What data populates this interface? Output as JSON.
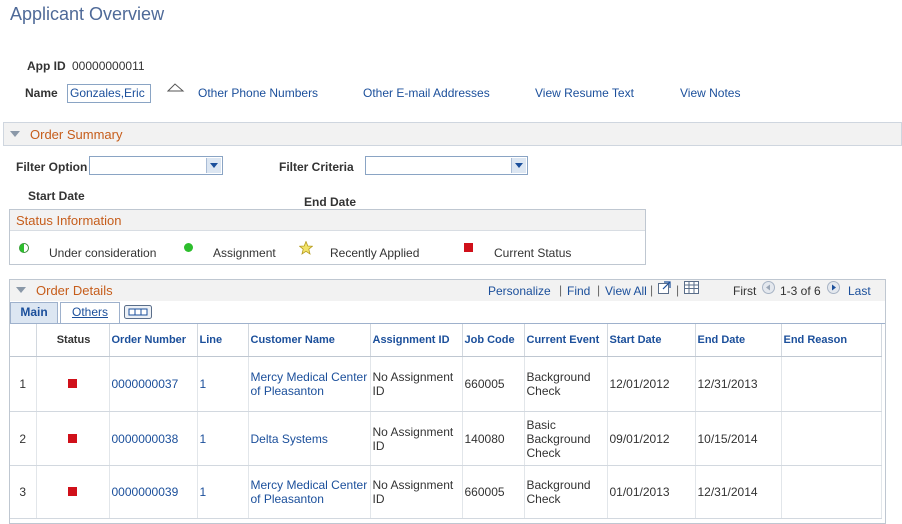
{
  "page": {
    "title": "Applicant Overview"
  },
  "applicant": {
    "app_id_label": "App ID",
    "app_id_value": "00000000011",
    "name_label": "Name",
    "name_value": "Gonzales,Eric",
    "links": [
      "Other Phone Numbers",
      "Other E-mail Addresses",
      "View Resume Text",
      "View Notes"
    ]
  },
  "order_summary": {
    "header": "Order Summary",
    "filter_option_label": "Filter Option",
    "filter_criteria_label": "Filter Criteria",
    "filter_option_value": "",
    "filter_criteria_value": "",
    "start_date_label": "Start Date",
    "end_date_label": "End Date"
  },
  "status_information": {
    "header": "Status Information",
    "legend": [
      {
        "icon": "half-circle-icon",
        "label": "Under consideration"
      },
      {
        "icon": "green-dot-icon",
        "label": "Assignment",
        "color": "#2DBE2D"
      },
      {
        "icon": "star-icon",
        "label": "Recently Applied",
        "color": "#E8D24A"
      },
      {
        "icon": "red-square-icon",
        "label": "Current Status",
        "color": "#D0101A"
      }
    ]
  },
  "order_details": {
    "header": "Order Details",
    "toolbar": {
      "personalize": "Personalize",
      "find": "Find",
      "view_all": "View All",
      "first": "First",
      "range": "1-3 of 6",
      "last": "Last"
    },
    "tabs": [
      "Main",
      "Others"
    ],
    "columns": [
      "Status",
      "Order Number",
      "Line",
      "Customer Name",
      "Assignment ID",
      "Job Code",
      "Current Event",
      "Start Date",
      "End Date",
      "End Reason"
    ],
    "rows": [
      {
        "num": "1",
        "order": "0000000037",
        "line": "1",
        "customer": "Mercy Medical Center of Pleasanton",
        "assignment": "No Assignment ID",
        "job": "660005",
        "event": "Background Check",
        "start": "12/01/2012",
        "end": "12/31/2013",
        "reason": ""
      },
      {
        "num": "2",
        "order": "0000000038",
        "line": "1",
        "customer": "Delta Systems",
        "assignment": "No Assignment ID",
        "job": "140080",
        "event": "Basic Background Check",
        "start": "09/01/2012",
        "end": "10/15/2014",
        "reason": ""
      },
      {
        "num": "3",
        "order": "0000000039",
        "line": "1",
        "customer": "Mercy Medical Center of Pleasanton",
        "assignment": "No Assignment ID",
        "job": "660005",
        "event": "Background Check",
        "start": "01/01/2013",
        "end": "12/31/2014",
        "reason": ""
      }
    ]
  }
}
